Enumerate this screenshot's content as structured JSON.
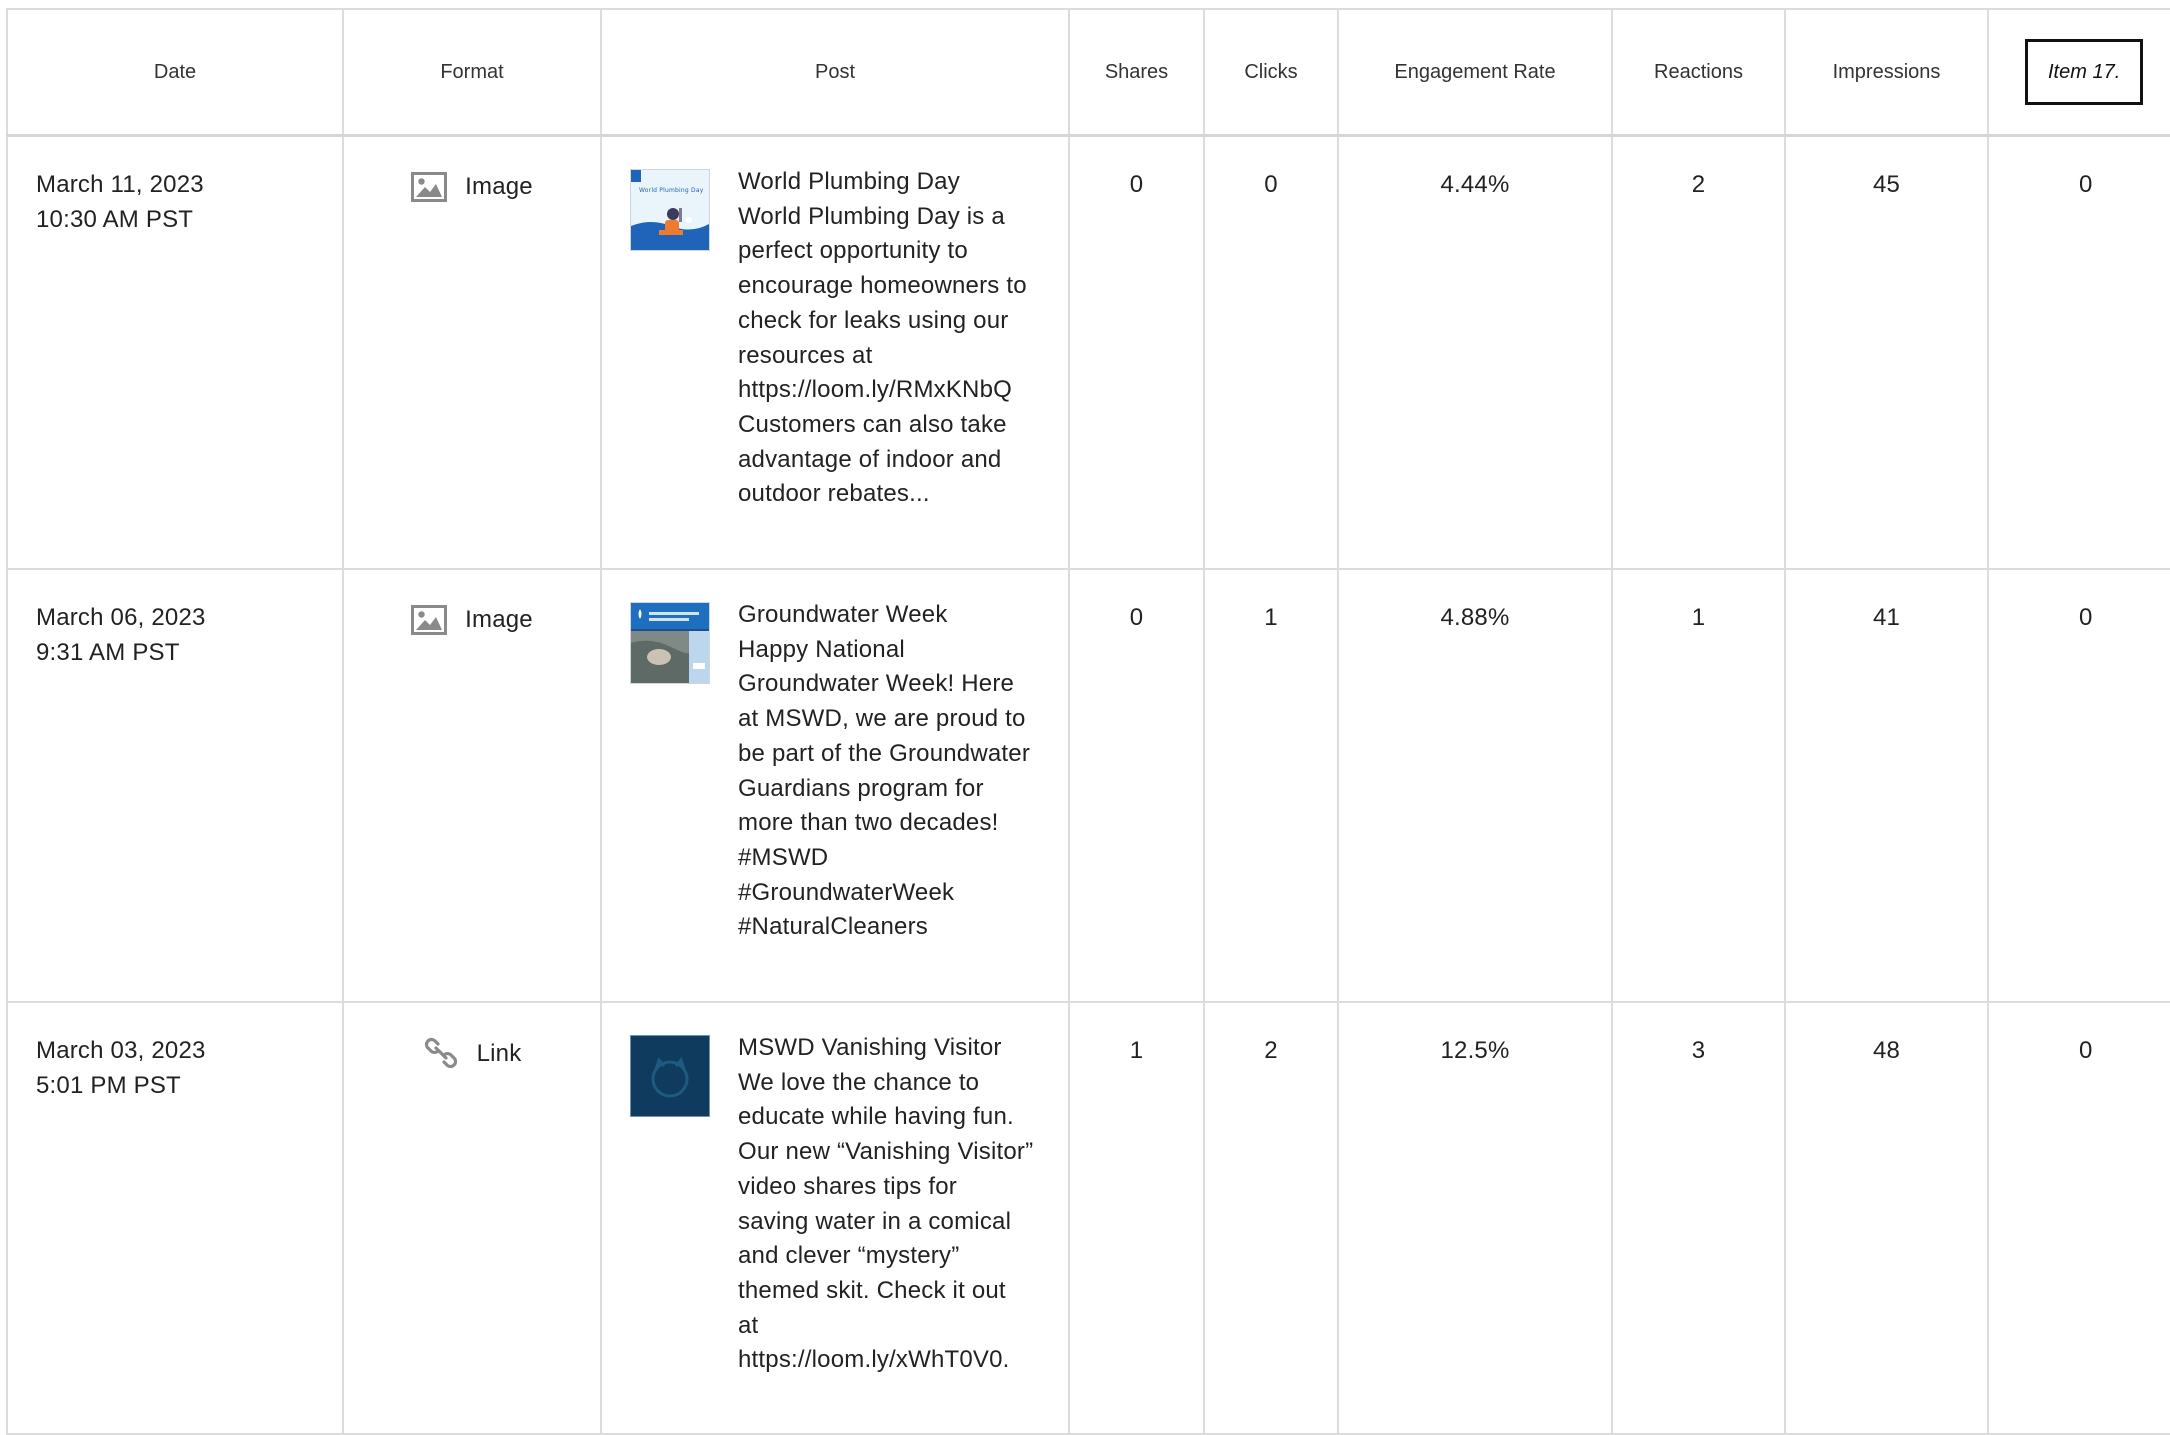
{
  "table": {
    "columns": {
      "date": "Date",
      "format": "Format",
      "post": "Post",
      "shares": "Shares",
      "clicks": "Clicks",
      "engagement_rate": "Engagement Rate",
      "reactions": "Reactions",
      "impressions": "Impressions",
      "item": "Item 17."
    },
    "rows": [
      {
        "date": "March 11, 2023",
        "time": "10:30 AM PST",
        "format_icon": "image-icon",
        "format": "Image",
        "thumbnail": "world-plumbing-day-thumbnail",
        "post_lines": [
          "World Plumbing Day",
          "World Plumbing Day is a",
          "perfect opportunity to",
          "encourage homeowners to",
          "check for leaks using our",
          "resources at",
          "https://loom.ly/RMxKNbQ",
          "Customers can also take",
          "advantage of indoor and",
          "outdoor rebates..."
        ],
        "shares": "0",
        "clicks": "0",
        "engagement_rate": "4.44%",
        "reactions": "2",
        "impressions": "45",
        "item": "0"
      },
      {
        "date": "March 06, 2023",
        "time": "9:31 AM PST",
        "format_icon": "image-icon",
        "format": "Image",
        "thumbnail": "groundwater-week-thumbnail",
        "post_lines": [
          "Groundwater Week",
          "Happy National",
          "Groundwater Week! Here",
          "at MSWD, we are proud to",
          "be part of the Groundwater",
          "Guardians program for",
          "more than two decades!",
          "#MSWD",
          "#GroundwaterWeek",
          "#NaturalCleaners"
        ],
        "shares": "0",
        "clicks": "1",
        "engagement_rate": "4.88%",
        "reactions": "1",
        "impressions": "41",
        "item": "0"
      },
      {
        "date": "March 03, 2023",
        "time": "5:01 PM PST",
        "format_icon": "link-icon",
        "format": "Link",
        "thumbnail": "vanishing-visitor-thumbnail",
        "post_lines": [
          "MSWD Vanishing Visitor",
          "We love the chance to",
          "educate while having fun.",
          "Our new “Vanishing Visitor”",
          "video shares tips for",
          "saving water in a comical",
          "and clever “mystery”",
          "themed skit. Check it out",
          "at",
          "https://loom.ly/xWhT0V0."
        ],
        "shares": "1",
        "clicks": "2",
        "engagement_rate": "12.5%",
        "reactions": "3",
        "impressions": "48",
        "item": "0"
      }
    ]
  },
  "colors": {
    "border": "#dcdcdc",
    "icon_gray": "#8a8a8a",
    "thumb_blue": "#1f64b8",
    "thumb_dark": "#0f3b5e"
  }
}
